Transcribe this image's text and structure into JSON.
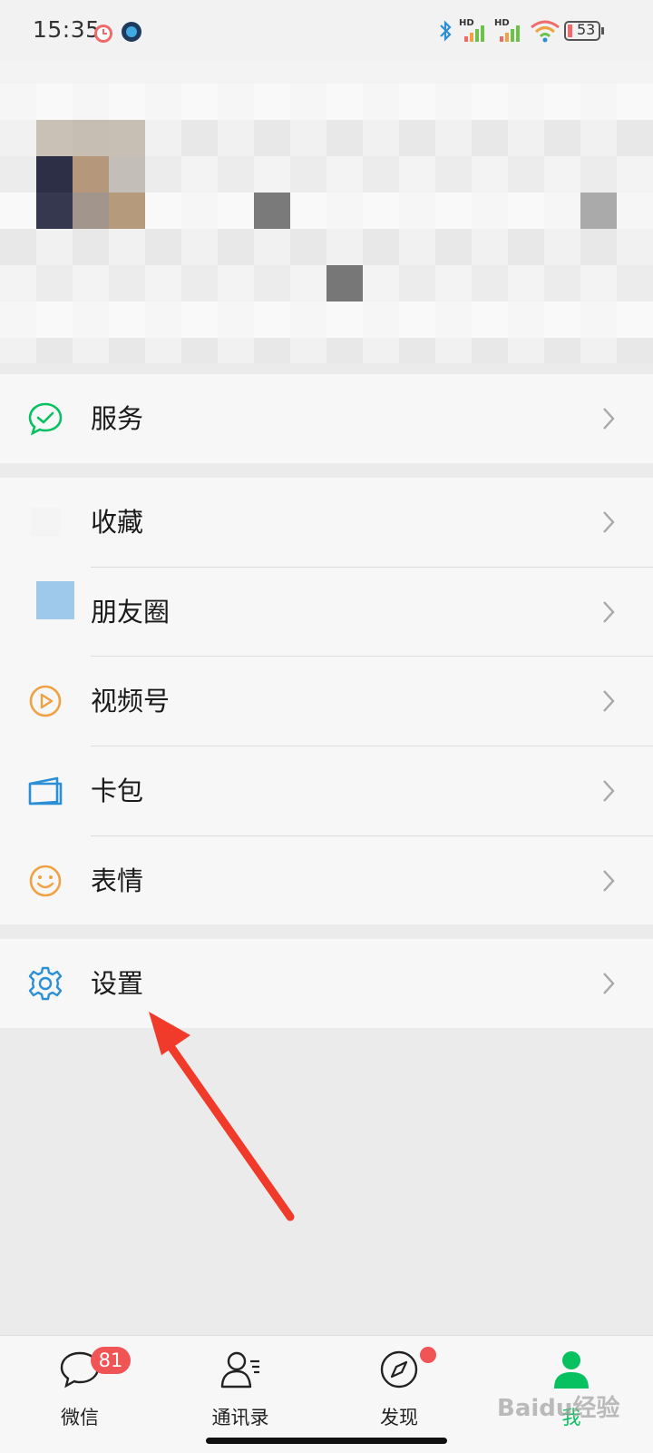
{
  "status_bar": {
    "time": "15:35",
    "battery": "53",
    "icons": [
      "alarm-icon",
      "app-icon",
      "bluetooth-icon",
      "signal-hd-icon",
      "signal-hd-icon",
      "wifi-icon",
      "battery-icon"
    ]
  },
  "profile": {
    "blurred": true
  },
  "menu": {
    "services": {
      "label": "服务",
      "icon": "services-icon"
    },
    "group": [
      {
        "label": "收藏",
        "icon": "favorites-icon"
      },
      {
        "label": "朋友圈",
        "icon": "moments-icon"
      },
      {
        "label": "视频号",
        "icon": "channels-icon"
      },
      {
        "label": "卡包",
        "icon": "card-wallet-icon"
      },
      {
        "label": "表情",
        "icon": "stickers-icon"
      }
    ],
    "settings": {
      "label": "设置",
      "icon": "settings-icon"
    }
  },
  "tabbar": {
    "tabs": [
      {
        "label": "微信",
        "icon": "chats-icon",
        "badge": "81"
      },
      {
        "label": "通讯录",
        "icon": "contacts-icon"
      },
      {
        "label": "发现",
        "icon": "discover-icon"
      },
      {
        "label": "我",
        "icon": "me-icon",
        "active": true
      }
    ]
  },
  "watermark": "Baidu经验",
  "colors": {
    "accent_green": "#07c160",
    "badge_red": "#f05454",
    "arrow_red": "#f03a2a",
    "icon_orange": "#f0a142",
    "icon_blue": "#2b8fd6"
  }
}
